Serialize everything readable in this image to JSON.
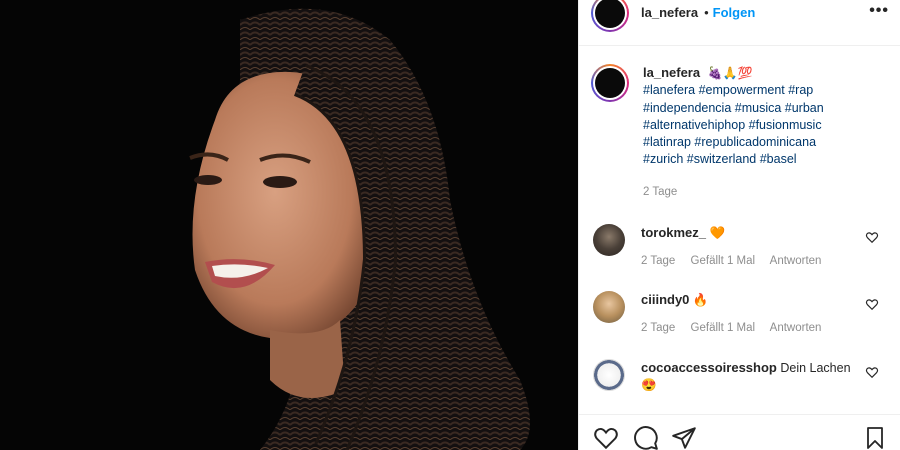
{
  "post": {
    "username": "la_nefera",
    "separator": "•",
    "follow_label": "Folgen",
    "more_label": "•••"
  },
  "caption": {
    "username": "la_nefera",
    "emojis": "🍇🙏💯",
    "hashtags": "#lanefera #empowerment #rap #independencia #musica #urban #alternativehiphop #fusionmusic #latinrap #republicadominicana #zurich #switzerland #basel",
    "age": "2 Tage"
  },
  "comments": [
    {
      "username": "torokmez_",
      "text": "🧡",
      "age": "2 Tage",
      "likes": "Gefällt 1 Mal",
      "reply": "Antworten"
    },
    {
      "username": "ciiindy0",
      "text": "🔥",
      "age": "2 Tage",
      "likes": "Gefällt 1 Mal",
      "reply": "Antworten"
    },
    {
      "username": "cocoaccessoiresshop",
      "text": "Dein Lachen",
      "text2": "😍"
    }
  ],
  "icons": {
    "like": "heart-icon",
    "comment": "comment-icon",
    "share": "share-icon",
    "save": "bookmark-icon"
  },
  "colors": {
    "link": "#00376b",
    "follow": "#0095f6",
    "muted": "#8e8e8e"
  }
}
